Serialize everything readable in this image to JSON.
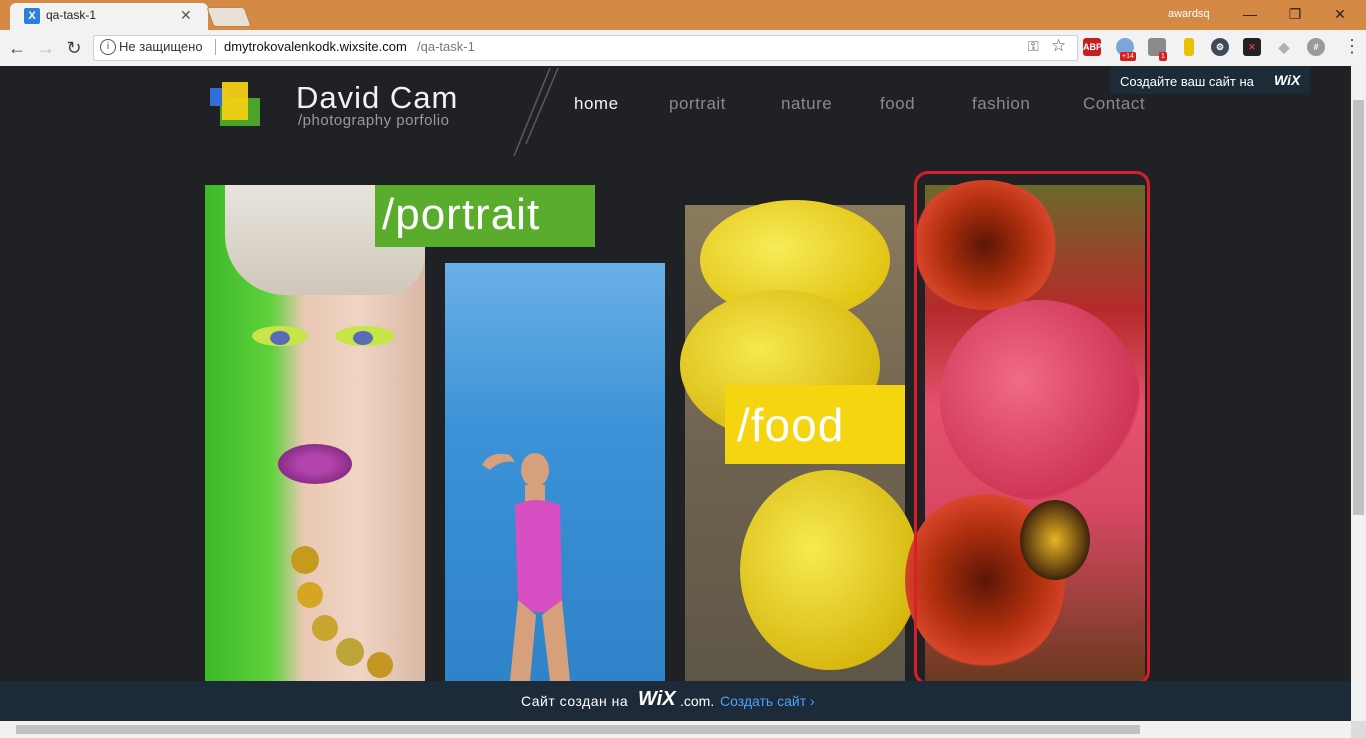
{
  "browser": {
    "tab_title": "qa-task-1",
    "tab_favicon": "X",
    "user": "awardsq",
    "security_label": "Не защищено",
    "url_host": "dmytrokovalenkodk.wixsite.com",
    "url_path": "/qa-task-1",
    "extensions": [
      {
        "name": "adblock-plus-icon",
        "label": "ABP",
        "color": "#c41f1f"
      },
      {
        "name": "cloud-extension-icon",
        "label": "",
        "badge": "+14",
        "color": "#7aa6d8"
      },
      {
        "name": "shield-extension-icon",
        "label": "",
        "badge": "1",
        "color": "#8a8a8a"
      },
      {
        "name": "bulb-extension-icon",
        "label": "",
        "color": "#e6c200"
      },
      {
        "name": "gear-extension-icon",
        "label": "",
        "color": "#3c4a5a"
      },
      {
        "name": "x-extension-icon",
        "label": "",
        "color": "#222222"
      },
      {
        "name": "diamond-extension-icon",
        "label": "",
        "color": "#b0b0b0"
      },
      {
        "name": "circle-extension-icon",
        "label": "",
        "color": "#9a9a9a"
      }
    ]
  },
  "site": {
    "title": "David Cam",
    "subtitle": "/photography porfolio",
    "nav": [
      "home",
      "portrait",
      "nature",
      "food",
      "fashion",
      "Contact"
    ],
    "active_nav": "home",
    "wix_promo": {
      "text": "Создайте ваш сайт на",
      "logo": "WiX"
    },
    "gallery": [
      {
        "name": "portrait",
        "label": "/portrait",
        "label_color": "#5aad2c"
      },
      {
        "name": "fashion",
        "label": ""
      },
      {
        "name": "food",
        "label": "/food",
        "label_color": "#f5d50f"
      },
      {
        "name": "nature",
        "label": "",
        "highlighted": true
      }
    ],
    "footer": {
      "text": "Сайт создан на",
      "logo": "WiX",
      "domain": ".com.",
      "link": "Создать сайт ›"
    }
  },
  "colors": {
    "accent_highlight": "#d81f2a",
    "page_bg": "#202124",
    "footer_bg": "#1d2a38"
  }
}
